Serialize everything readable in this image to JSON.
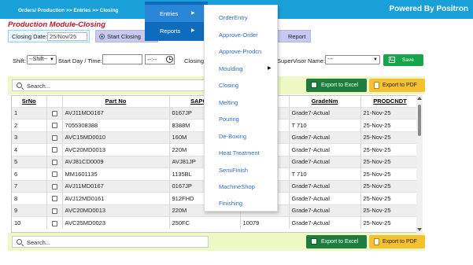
{
  "header": {
    "breadcrumb": "Orders/ Production >> Entries >> Closing",
    "powered_by": "Powered By Positron"
  },
  "page": {
    "title": "Production Module-Closing"
  },
  "form": {
    "closing_date_label": "Closing Date:",
    "closing_date_value": "25/Nov/25",
    "radio_start_closing": "Start Closing",
    "radio_report": "Report",
    "shift_label": "Shift:",
    "shift_value": "--Shift--",
    "start_day_time_label": "Start Day / Time:",
    "start_time_value": "--:--",
    "closing_label": "Closing",
    "supervisor_label": "SuperVisor Name:",
    "supervisor_value": "---",
    "save_label": "Save"
  },
  "toolbar": {
    "search_placeholder": "Search...",
    "export_excel": "Export to Excel",
    "export_pdf": "Export to PDF"
  },
  "table": {
    "columns": [
      "SrNo",
      "",
      "Part No",
      "SAPCTitle",
      "",
      "GradeNm",
      "PRODCNDT"
    ],
    "rows": [
      [
        "1",
        "",
        "AVJ11MD0167",
        "0167JP",
        "",
        "Grade7-Actual",
        "21-Nov-25"
      ],
      [
        "2",
        "",
        "7055308388",
        "8388M",
        "",
        "T 710",
        "25-Nov-25"
      ],
      [
        "3",
        "",
        "AVC15MD0010",
        "160M",
        "",
        "Grade7-Actual",
        "25-Nov-25"
      ],
      [
        "4",
        "",
        "AVC20MD0013",
        "220M",
        "",
        "Grade7-Actual",
        "25-Nov-25"
      ],
      [
        "5",
        "",
        "AVJ81CD0009",
        "AVJ81JP",
        "",
        "Grade7-Actual",
        "25-Nov-25"
      ],
      [
        "6",
        "",
        "MM1601135",
        "1135BL",
        "",
        "T 710",
        "25-Nov-25"
      ],
      [
        "7",
        "",
        "AVJ11MD0167",
        "0167JP",
        "",
        "Grade7-Actual",
        "25-Nov-25"
      ],
      [
        "8",
        "",
        "AVJ12MD0161",
        "912FHD",
        "",
        "Grade7-Actual",
        "25-Nov-25"
      ],
      [
        "9",
        "",
        "AVC20MD0013",
        "220M",
        "",
        "Grade7-Actual",
        "25-Nov-25"
      ],
      [
        "10",
        "",
        "AVC25MD0023",
        "250FC",
        "10079",
        "Grade7-Actual",
        "25-Nov-25"
      ]
    ]
  },
  "menu": {
    "top": [
      "Entries",
      "Reports"
    ],
    "entries": [
      "OrderEntry",
      "Approve-Order",
      "Approve-Prodcn",
      "Moulding",
      "Closing",
      "Melting",
      "Pouring",
      "De-Boxing",
      "Heat Treatment",
      "SemiFinish",
      "MachineShop",
      "Finishing"
    ]
  },
  "colors": {
    "header_bar": "#1aa0d8",
    "title_red": "#c0182a",
    "menu_blue": "#0f6cbd",
    "toolbar_bg": "#eef8c4",
    "save_green": "#17a54b",
    "excel_green": "#1d7d3e",
    "pdf_yellow": "#f5c131",
    "submenu_link": "#2e6fc4"
  },
  "icons": [
    "search-icon",
    "clock-icon",
    "save-icon",
    "excel-icon",
    "pdf-icon",
    "chevron-right-icon",
    "checkbox-icon"
  ]
}
